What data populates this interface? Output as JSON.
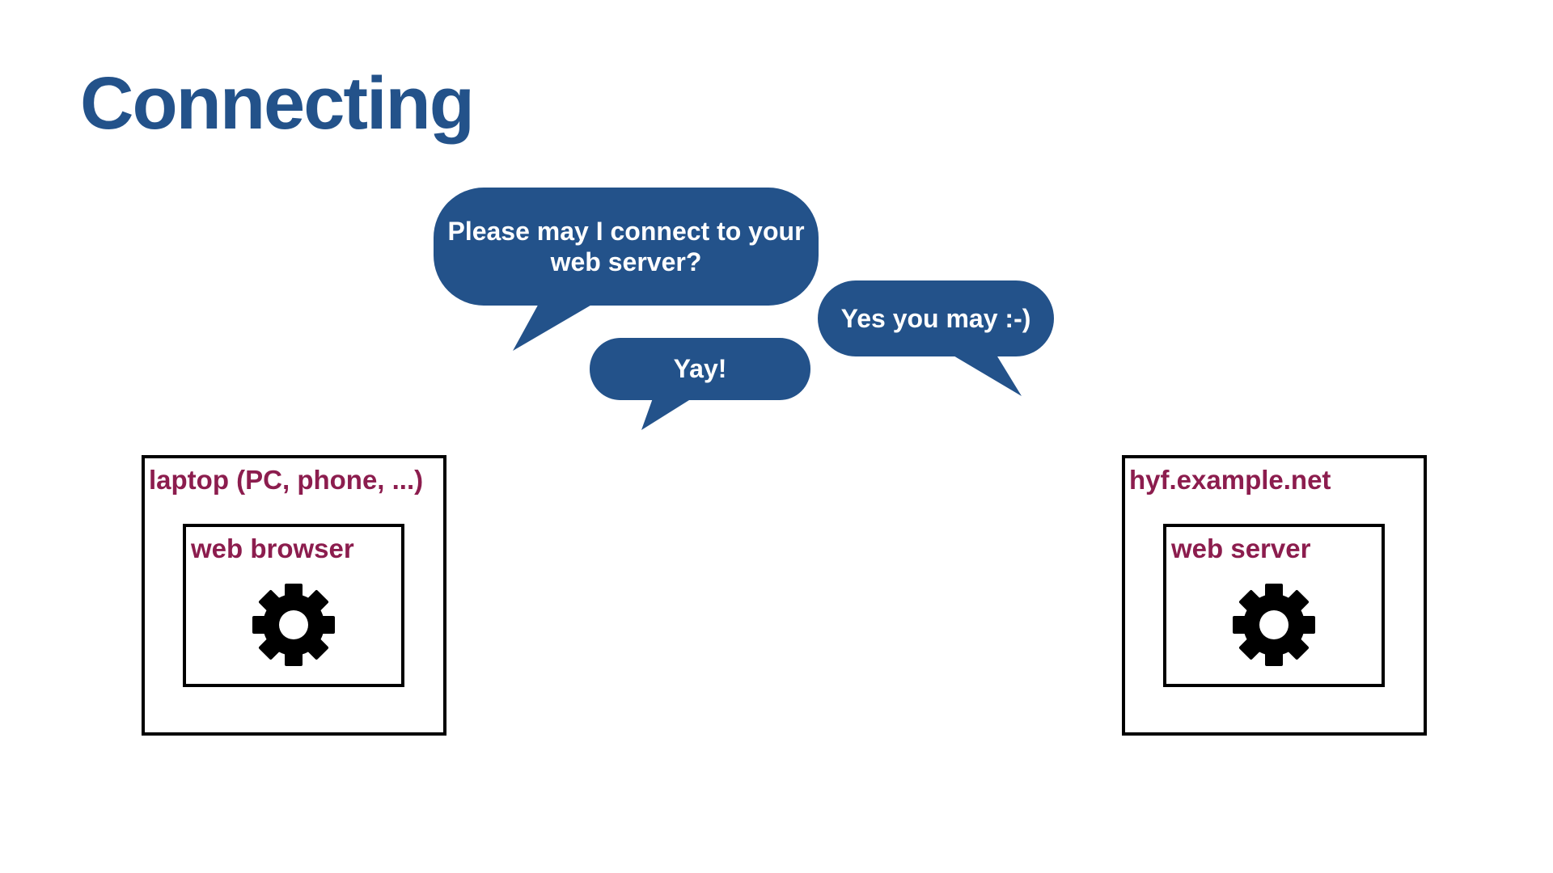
{
  "slide": {
    "title": "Connecting"
  },
  "bubbles": {
    "request": "Please may I connect to your web server?",
    "reply": "Yes you may :-)",
    "cheer": "Yay!"
  },
  "client": {
    "outer_label": "laptop (PC, phone, ...)",
    "inner_label": "web browser",
    "icon": "gear-icon"
  },
  "server": {
    "outer_label": "hyf.example.net",
    "inner_label": "web server",
    "icon": "gear-icon"
  },
  "colors": {
    "title": "#23528a",
    "bubble": "#23528a",
    "label": "#8c1d4e",
    "border": "#000000"
  }
}
